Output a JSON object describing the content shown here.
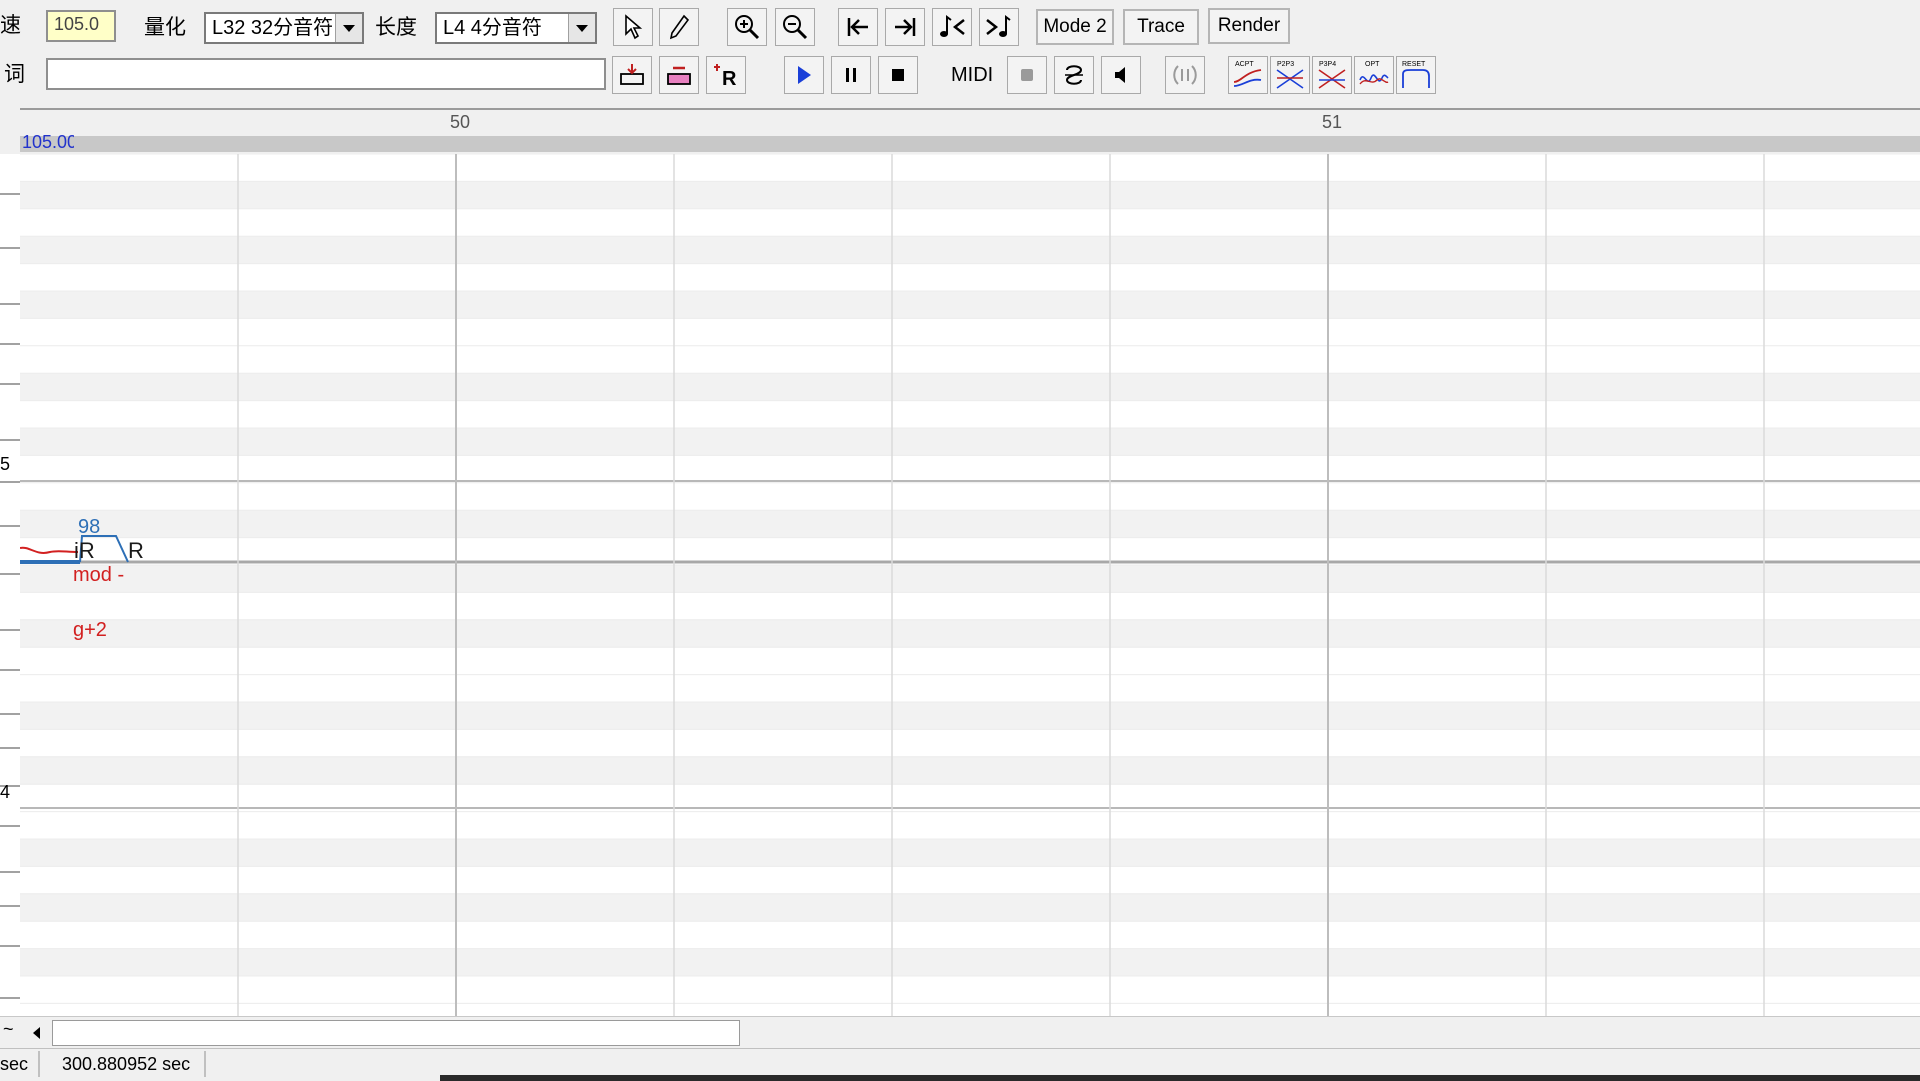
{
  "toolbar": {
    "tempo_label": "速",
    "tempo_value": "105.0",
    "quantize_label": "量化",
    "quantize_value": "L32 32分音符",
    "length_label": "长度",
    "length_value": "L4  4分音符",
    "lyrics_label": "词",
    "lyrics_value": "",
    "mode_button": "Mode 2",
    "trace_button": "Trace",
    "render_button": "Render",
    "midi_label": "MIDI",
    "icon_texts": [
      "ACPT",
      "P2P3",
      "P3P4",
      "OPT",
      "RESET"
    ]
  },
  "ruler": {
    "tempo_mark": "105.00",
    "measure_50": "50",
    "measure_51": "51"
  },
  "piano": {
    "labels": [
      "5",
      "4"
    ]
  },
  "notes": {
    "velocity": "98",
    "note_lyric": "iR",
    "rest_lyric": "R",
    "mod_label": "mod -",
    "g_label": "g+2"
  },
  "status": {
    "left_unit": "sec",
    "time": "300.880952 sec"
  },
  "colors": {
    "accent_blue": "#2d6fb6",
    "note_red": "#d22020",
    "play_blue": "#1a3fd8"
  }
}
